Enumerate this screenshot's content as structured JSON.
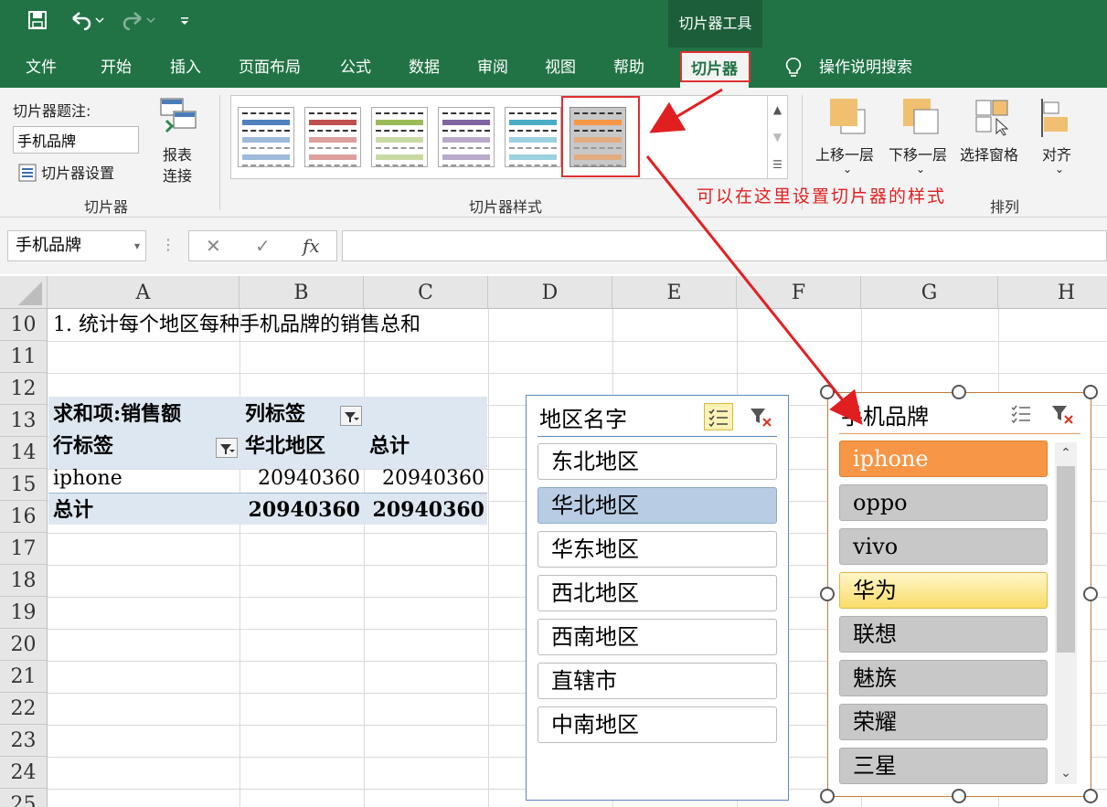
{
  "quick_access": {
    "save_icon": "save-icon",
    "undo_icon": "undo-icon",
    "redo_icon": "redo-icon",
    "customize_icon": "customize-qat-icon"
  },
  "context_tool": "切片器工具",
  "tabs": [
    "文件",
    "开始",
    "插入",
    "页面布局",
    "公式",
    "数据",
    "审阅",
    "视图",
    "帮助",
    "切片器"
  ],
  "tell_me": "操作说明搜索",
  "ribbon": {
    "caption_label": "切片器题注:",
    "caption_value": "手机品牌",
    "settings_label": "切片器设置",
    "report_connections": [
      "报表",
      "连接"
    ],
    "group_slicer": "切片器",
    "group_styles": "切片器样式",
    "group_arrange": "排列",
    "bring_forward": "上移一层",
    "send_backward": "下移一层",
    "selection_pane": "选择窗格",
    "align": "对齐",
    "style_colors": [
      "#4f81bd",
      "#c0504d",
      "#9bbb59",
      "#8064a2",
      "#4bacc6",
      "#f79646"
    ],
    "selected_style_index": 5
  },
  "formula_bar": {
    "name_box": "手机品牌",
    "cancel": "✕",
    "enter": "✓",
    "fx": "fx",
    "formula": ""
  },
  "columns": [
    "A",
    "B",
    "C",
    "D",
    "E",
    "F",
    "G",
    "H"
  ],
  "rows": [
    "10",
    "11",
    "12",
    "13",
    "14",
    "15",
    "16",
    "17",
    "18",
    "19",
    "20",
    "21",
    "22",
    "23",
    "24",
    "25"
  ],
  "cells": {
    "a10": "1. 统计每个地区每种手机品牌的销售总和",
    "a13": "求和项:销售额",
    "b13": "列标签",
    "a14": "行标签",
    "b14": "华北地区",
    "c14": "总计",
    "a15": "iphone",
    "b15": "20940360",
    "c15": "20940360",
    "a16": "总计",
    "b16": "20940360",
    "c16": "20940360"
  },
  "slicer_region": {
    "title": "地区名字",
    "items": [
      "东北地区",
      "华北地区",
      "华东地区",
      "西北地区",
      "西南地区",
      "直辖市",
      "中南地区"
    ],
    "selected": "华北地区"
  },
  "slicer_brand": {
    "title": "手机品牌",
    "items": [
      "iphone",
      "oppo",
      "vivo",
      "华为",
      "联想",
      "魅族",
      "荣耀",
      "三星"
    ],
    "selected": "iphone",
    "hovered": "华为"
  },
  "annotation": "可以在这里设置切片器的样式"
}
